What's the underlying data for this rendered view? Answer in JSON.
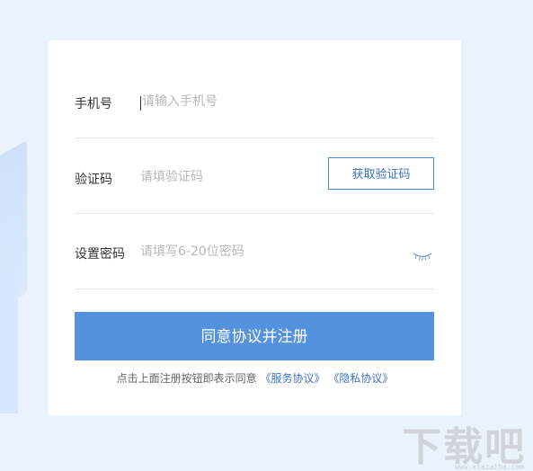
{
  "form": {
    "phone": {
      "label": "手机号",
      "placeholder": "请输入手机号"
    },
    "code": {
      "label": "验证码",
      "placeholder": "请填验证码",
      "button_label": "获取验证码"
    },
    "password": {
      "label": "设置密码",
      "placeholder": "请填写6-20位密码",
      "toggle_icon": "eye-closed-icon"
    },
    "submit_label": "同意协议并注册",
    "agreement": {
      "prefix": "点击上面注册按钮即表示同意",
      "service_link": "《服务协议》",
      "privacy_link": "《隐私协议》"
    }
  },
  "watermark": {
    "text": "下载吧",
    "url": "www.xiazaiba.com"
  },
  "colors": {
    "background": "#eaf2fd",
    "accent": "#5592de",
    "link": "#3d73c5",
    "button_border": "#4d87d6"
  }
}
